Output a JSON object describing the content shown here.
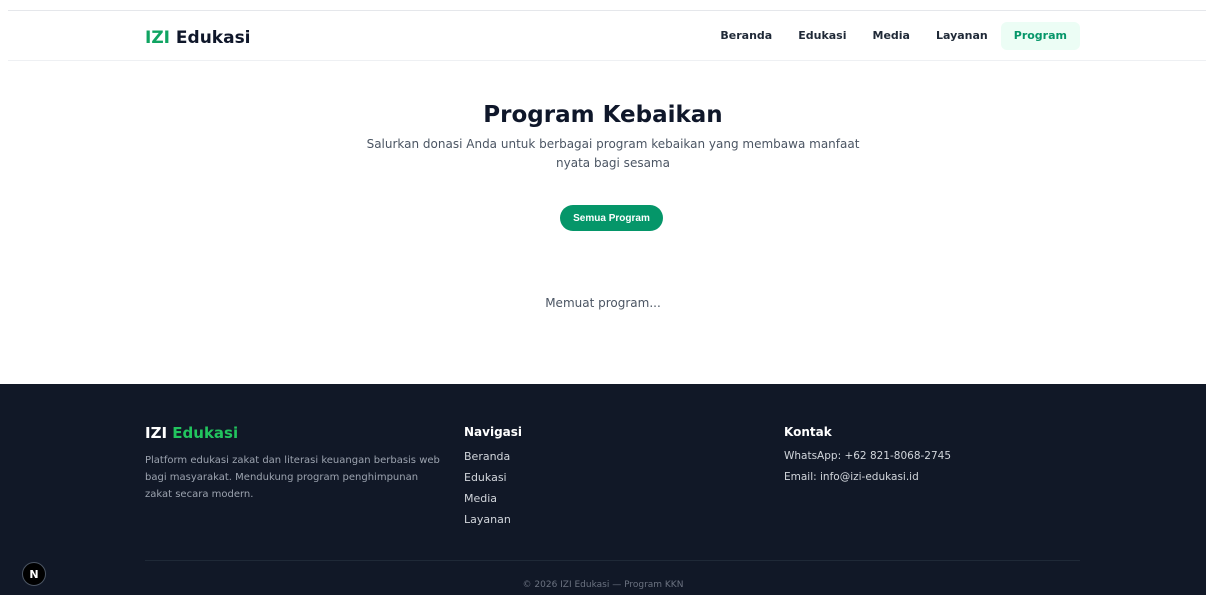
{
  "header": {
    "brand_prefix": "IZI",
    "brand_suffix": "Edukasi",
    "nav": [
      {
        "label": "Beranda",
        "active": false
      },
      {
        "label": "Edukasi",
        "active": false
      },
      {
        "label": "Media",
        "active": false
      },
      {
        "label": "Layanan",
        "active": false
      },
      {
        "label": "Program",
        "active": true
      }
    ]
  },
  "hero": {
    "title": "Program Kebaikan",
    "subtitle": "Salurkan donasi Anda untuk berbagai program kebaikan yang membawa manfaat nyata bagi sesama",
    "button_label": "Semua Program"
  },
  "main": {
    "loading_text": "Memuat program..."
  },
  "footer": {
    "brand_prefix": "IZI",
    "brand_suffix": "Edukasi",
    "description": "Platform edukasi zakat dan literasi keuangan berbasis web bagi masyarakat. Mendukung program penghimpunan zakat secara modern.",
    "nav_heading": "Navigasi",
    "nav_links": [
      "Beranda",
      "Edukasi",
      "Media",
      "Layanan"
    ],
    "contact_heading": "Kontak",
    "contact_lines": [
      "WhatsApp: +62 821-8068-2745",
      "Email: info@izi-edukasi.id"
    ],
    "copyright": "© 2026 IZI Edukasi — Program KKN"
  },
  "dev_badge": {
    "label": "N"
  },
  "colors": {
    "accent": "#059669",
    "brand_green": "#10a462",
    "footer_bg": "#111827",
    "active_nav_bg": "#ecfdf5"
  }
}
